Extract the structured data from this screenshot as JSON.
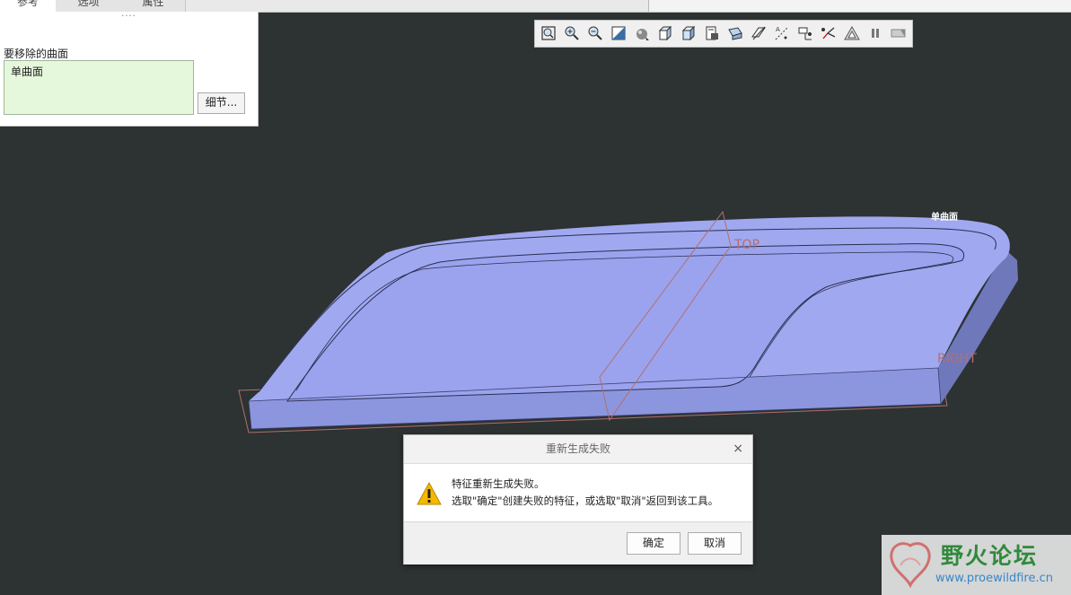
{
  "tabs": [
    {
      "label": "参考",
      "active": true
    },
    {
      "label": "选项",
      "active": false
    },
    {
      "label": "属性",
      "active": false
    }
  ],
  "panel": {
    "grip": "····",
    "collector_label": "要移除的曲面",
    "collector_value": "单曲面",
    "details_button": "细节..."
  },
  "toolbar": {
    "icons": [
      "zoom-fit-icon",
      "zoom-in-icon",
      "zoom-out-icon",
      "repaint-icon",
      "display-style-icon",
      "standard-orientation-icon",
      "saved-orientations-icon",
      "view-manager-icon",
      "perspective-icon",
      "datum-planes-display-icon",
      "datum-axes-display-icon",
      "point-display-icon",
      "csys-display-icon",
      "annotation-display-icon",
      "pause-icon",
      "spin-center-icon"
    ]
  },
  "scene": {
    "label_surface": "单曲面",
    "label_top": "TOP",
    "label_right": "RIGHT",
    "colors": {
      "part_face": "#a0a8f0",
      "part_side": "#7b84cc",
      "datum": "#b0706e"
    }
  },
  "dialog": {
    "title": "重新生成失败",
    "close": "×",
    "line1": "特征重新生成失败。",
    "line2": "选取\"确定\"创建失败的特征，或选取\"取消\"返回到该工具。",
    "ok": "确定",
    "cancel": "取消"
  },
  "watermark": {
    "title": "野火论坛",
    "url": "www.proewildfire.cn"
  }
}
